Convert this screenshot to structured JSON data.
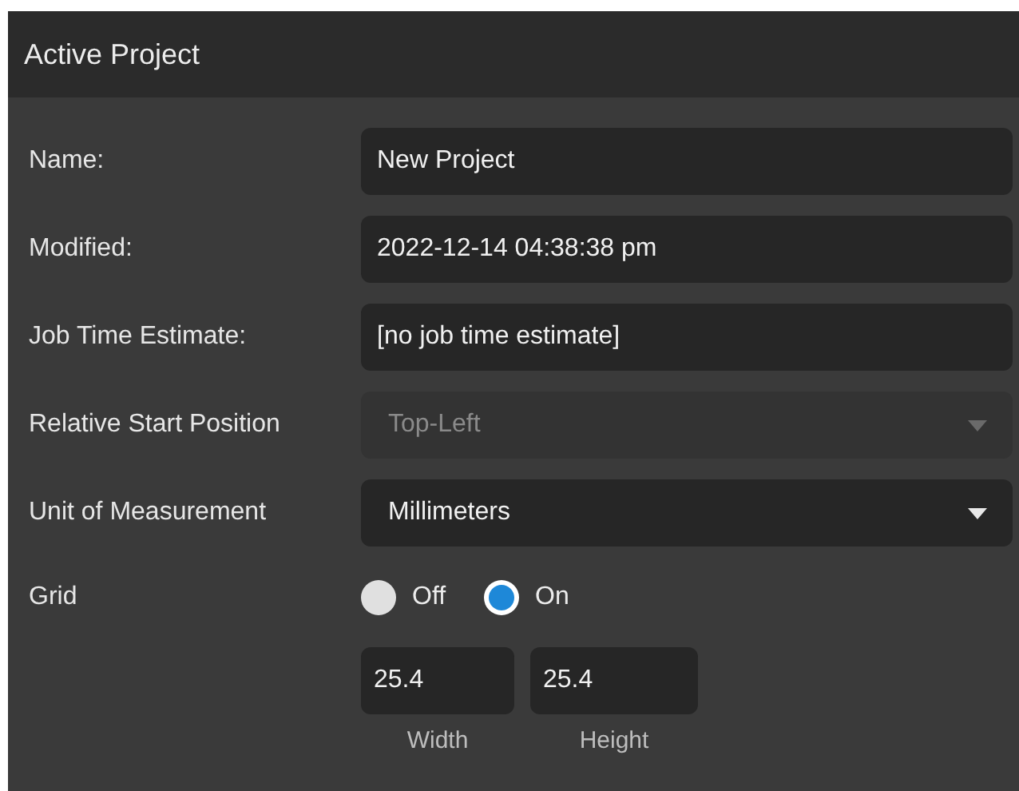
{
  "panel": {
    "title": "Active Project"
  },
  "fields": [
    {
      "kind": "text",
      "label": "Name:",
      "value": "New Project",
      "disabled": false
    },
    {
      "kind": "text",
      "label": "Modified:",
      "value": "2022-12-14 04:38:38 pm",
      "disabled": false
    },
    {
      "kind": "text",
      "label": "Job Time Estimate:",
      "value": "[no job time estimate]",
      "disabled": false
    },
    {
      "kind": "dropdown",
      "label": "Relative Start Position",
      "value": "Top-Left",
      "disabled": true
    },
    {
      "kind": "dropdown",
      "label": "Unit of Measurement",
      "value": "Millimeters",
      "disabled": false
    }
  ],
  "grid": {
    "label": "Grid",
    "options": [
      {
        "label": "Off",
        "selected": false
      },
      {
        "label": "On",
        "selected": true
      }
    ],
    "sizes": [
      {
        "value": "25.4",
        "caption": "Width"
      },
      {
        "value": "25.4",
        "caption": "Height"
      }
    ]
  }
}
